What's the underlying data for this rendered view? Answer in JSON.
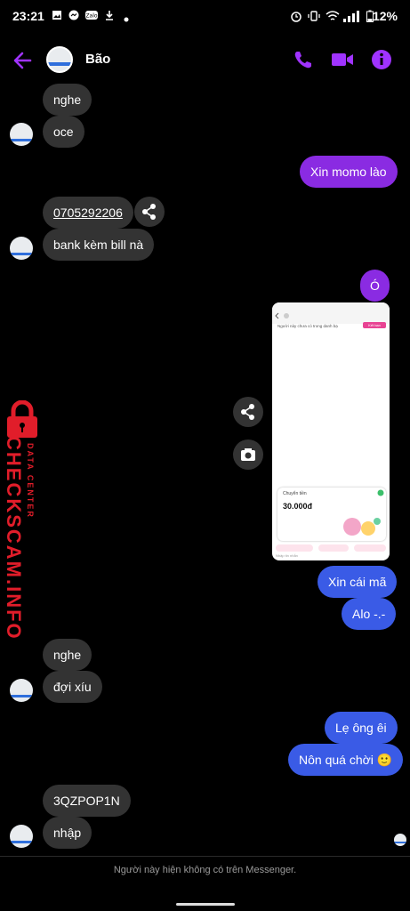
{
  "status_bar": {
    "time": "23:21",
    "battery": "12%",
    "notification_icons": [
      "image-icon",
      "messenger-icon",
      "zalo-icon",
      "download-icon",
      "dot-icon"
    ],
    "system_icons": [
      "alarm-icon",
      "vibrate-icon",
      "wifi-icon",
      "signal-icon",
      "battery-icon"
    ]
  },
  "header": {
    "contact_name": "Bão",
    "accent_color": "#a033ff",
    "actions": [
      "phone-icon",
      "video-call-icon",
      "info-icon"
    ]
  },
  "messages": [
    {
      "side": "in",
      "text": "nghe"
    },
    {
      "side": "in",
      "text": "oce"
    },
    {
      "side": "out",
      "text": "Xin momo lào"
    },
    {
      "side": "in",
      "text": "0705292206"
    },
    {
      "side": "in",
      "text": "bank kèm bill nà"
    },
    {
      "side": "out",
      "text": "Ó"
    },
    {
      "side": "out",
      "text": "[image]"
    },
    {
      "side": "out",
      "text": "Xin cái mã"
    },
    {
      "side": "out",
      "text": "Alo -.-"
    },
    {
      "side": "in",
      "text": "nghe"
    },
    {
      "side": "in",
      "text": "đợi xíu"
    },
    {
      "side": "out",
      "text": "Lẹ ông êi"
    },
    {
      "side": "out",
      "text": "Nôn quá chời 🙂"
    },
    {
      "side": "in",
      "text": "3QZPOP1N"
    },
    {
      "side": "in",
      "text": "nhập"
    }
  ],
  "shared_image": {
    "header_text": "Người này chưa có trong danh bạ",
    "button_text": "Kết bạn",
    "card_label": "Chuyển tiền",
    "amount": "30.000đ",
    "input_placeholder": "Nhập tin nhắn"
  },
  "watermark": {
    "main": "CHECKSCAM.INFO",
    "sub": "DATA CENTER"
  },
  "footer": {
    "note": "Người này hiện không có trên Messenger."
  },
  "colors": {
    "incoming_bubble": "#333333",
    "outgoing_purple": "#8a2be2",
    "outgoing_blue": "#3a5be6",
    "watermark_red": "#e11d2a"
  }
}
